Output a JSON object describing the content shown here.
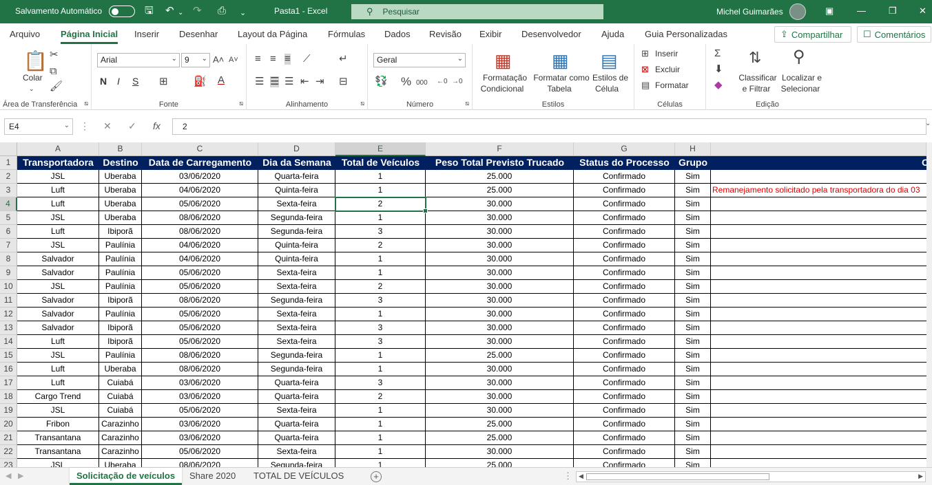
{
  "titlebar": {
    "autosave_label": "Salvamento Automático",
    "doc_title": "Pasta1 - Excel",
    "search_placeholder": "Pesquisar",
    "user_name": "Michel Guimarães"
  },
  "menu": {
    "tabs": [
      "Arquivo",
      "Página Inicial",
      "Inserir",
      "Desenhar",
      "Layout da Página",
      "Fórmulas",
      "Dados",
      "Revisão",
      "Exibir",
      "Desenvolvedor",
      "Ajuda",
      "Guia Personalizadas"
    ],
    "share": "Compartilhar",
    "comments": "Comentários"
  },
  "ribbon": {
    "clipboard": {
      "label": "Área de Transferência",
      "paste": "Colar"
    },
    "font": {
      "label": "Fonte",
      "name": "Arial",
      "size": "9",
      "bold": "N",
      "italic": "I",
      "underline": "S"
    },
    "alignment": {
      "label": "Alinhamento"
    },
    "number": {
      "label": "Número",
      "format": "Geral"
    },
    "styles": {
      "label": "Estilos",
      "cond1": "Formatação",
      "cond2": "Condicional",
      "table1": "Formatar como",
      "table2": "Tabela",
      "cell1": "Estilos de",
      "cell2": "Célula"
    },
    "cells": {
      "label": "Células",
      "insert": "Inserir",
      "delete": "Excluir",
      "format": "Formatar"
    },
    "editing": {
      "label": "Edição",
      "sort1": "Classificar",
      "sort2": "e Filtrar",
      "find1": "Localizar e",
      "find2": "Selecionar"
    }
  },
  "formula": {
    "name_box": "E4",
    "value": "2"
  },
  "columns": [
    "A",
    "B",
    "C",
    "D",
    "E",
    "F",
    "G",
    "H"
  ],
  "headers": [
    "Transportadora",
    "Destino",
    "Data de Carregamento",
    "Dia da Semana",
    "Total de Veículos",
    "Peso Total Previsto Trucado",
    "Status do Processo",
    "Grupo"
  ],
  "header_overflow": "O",
  "note_row3": "Remanejamento solicitado pela transportadora do dia 03",
  "rows": [
    [
      "JSL",
      "Uberaba",
      "03/06/2020",
      "Quarta-feira",
      "1",
      "25.000",
      "Confirmado",
      "Sim"
    ],
    [
      "Luft",
      "Uberaba",
      "04/06/2020",
      "Quinta-feira",
      "1",
      "25.000",
      "Confirmado",
      "Sim"
    ],
    [
      "Luft",
      "Uberaba",
      "05/06/2020",
      "Sexta-feira",
      "2",
      "30.000",
      "Confirmado",
      "Sim"
    ],
    [
      "JSL",
      "Uberaba",
      "08/06/2020",
      "Segunda-feira",
      "1",
      "30.000",
      "Confirmado",
      "Sim"
    ],
    [
      "Luft",
      "Ibiporã",
      "08/06/2020",
      "Segunda-feira",
      "3",
      "30.000",
      "Confirmado",
      "Sim"
    ],
    [
      "JSL",
      "Paulínia",
      "04/06/2020",
      "Quinta-feira",
      "2",
      "30.000",
      "Confirmado",
      "Sim"
    ],
    [
      "Salvador",
      "Paulínia",
      "04/06/2020",
      "Quinta-feira",
      "1",
      "30.000",
      "Confirmado",
      "Sim"
    ],
    [
      "Salvador",
      "Paulínia",
      "05/06/2020",
      "Sexta-feira",
      "1",
      "30.000",
      "Confirmado",
      "Sim"
    ],
    [
      "JSL",
      "Paulínia",
      "05/06/2020",
      "Sexta-feira",
      "2",
      "30.000",
      "Confirmado",
      "Sim"
    ],
    [
      "Salvador",
      "Ibiporã",
      "08/06/2020",
      "Segunda-feira",
      "3",
      "30.000",
      "Confirmado",
      "Sim"
    ],
    [
      "Salvador",
      "Paulínia",
      "05/06/2020",
      "Sexta-feira",
      "1",
      "30.000",
      "Confirmado",
      "Sim"
    ],
    [
      "Salvador",
      "Ibiporã",
      "05/06/2020",
      "Sexta-feira",
      "3",
      "30.000",
      "Confirmado",
      "Sim"
    ],
    [
      "Luft",
      "Ibiporã",
      "05/06/2020",
      "Sexta-feira",
      "3",
      "30.000",
      "Confirmado",
      "Sim"
    ],
    [
      "JSL",
      "Paulínia",
      "08/06/2020",
      "Segunda-feira",
      "1",
      "25.000",
      "Confirmado",
      "Sim"
    ],
    [
      "Luft",
      "Uberaba",
      "08/06/2020",
      "Segunda-feira",
      "1",
      "30.000",
      "Confirmado",
      "Sim"
    ],
    [
      "Luft",
      "Cuiabá",
      "03/06/2020",
      "Quarta-feira",
      "3",
      "30.000",
      "Confirmado",
      "Sim"
    ],
    [
      "Cargo Trend",
      "Cuiabá",
      "03/06/2020",
      "Quarta-feira",
      "2",
      "30.000",
      "Confirmado",
      "Sim"
    ],
    [
      "JSL",
      "Cuiabá",
      "05/06/2020",
      "Sexta-feira",
      "1",
      "30.000",
      "Confirmado",
      "Sim"
    ],
    [
      "Fribon",
      "Carazinho",
      "03/06/2020",
      "Quarta-feira",
      "1",
      "25.000",
      "Confirmado",
      "Sim"
    ],
    [
      "Transantana",
      "Carazinho",
      "03/06/2020",
      "Quarta-feira",
      "1",
      "25.000",
      "Confirmado",
      "Sim"
    ],
    [
      "Transantana",
      "Carazinho",
      "05/06/2020",
      "Sexta-feira",
      "1",
      "30.000",
      "Confirmado",
      "Sim"
    ],
    [
      "JSL",
      "Uberaba",
      "08/06/2020",
      "Segunda-feira",
      "1",
      "25.000",
      "Confirmado",
      "Sim"
    ]
  ],
  "sheets": [
    "Solicitação de veículos",
    "Share 2020",
    "TOTAL DE VEÍCULOS"
  ],
  "colors": {
    "excel_green": "#217346",
    "header_fill": "#002060",
    "note_red": "#e00000"
  }
}
